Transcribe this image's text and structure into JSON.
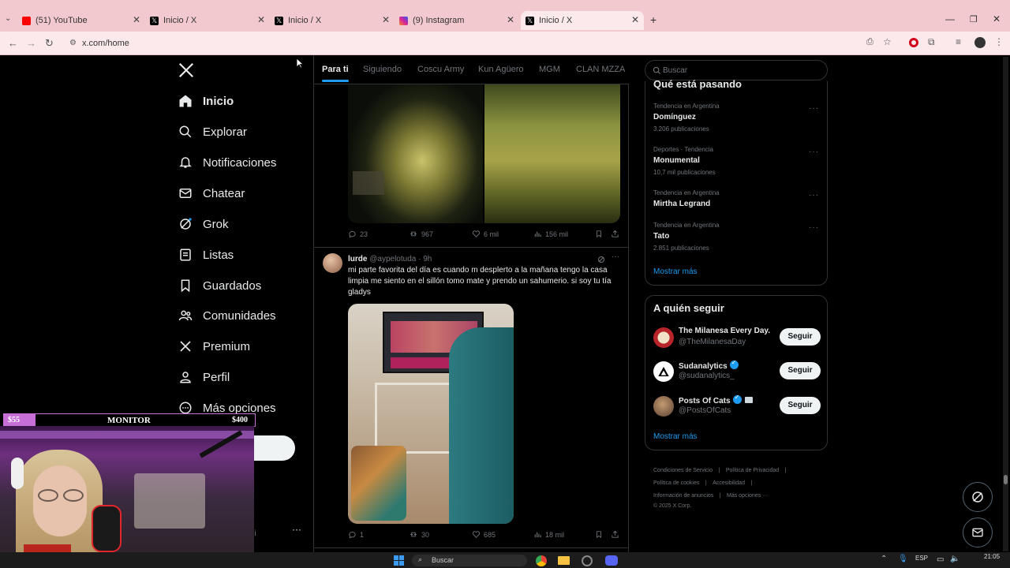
{
  "browser": {
    "tabs": [
      {
        "title": "(51) YouTube",
        "favicon": "youtube-icon",
        "color": "#ff0000"
      },
      {
        "title": "Inicio / X",
        "favicon": "x-icon",
        "color": "#000000"
      },
      {
        "title": "Inicio / X",
        "favicon": "x-icon",
        "color": "#000000"
      },
      {
        "title": "(9) Instagram",
        "favicon": "instagram-icon",
        "color": "#d6249f"
      },
      {
        "title": "Inicio / X",
        "favicon": "x-icon",
        "color": "#000000"
      }
    ],
    "url": "x.com/home"
  },
  "nav": {
    "items": [
      {
        "label": "Inicio",
        "icon": "home-icon"
      },
      {
        "label": "Explorar",
        "icon": "search-icon"
      },
      {
        "label": "Notificaciones",
        "icon": "bell-icon"
      },
      {
        "label": "Chatear",
        "icon": "mail-icon"
      },
      {
        "label": "Grok",
        "icon": "grok-icon"
      },
      {
        "label": "Listas",
        "icon": "list-icon"
      },
      {
        "label": "Guardados",
        "icon": "bookmark-icon"
      },
      {
        "label": "Comunidades",
        "icon": "people-icon"
      },
      {
        "label": "Premium",
        "icon": "x-icon"
      },
      {
        "label": "Perfil",
        "icon": "person-icon"
      },
      {
        "label": "Más opciones",
        "icon": "more-circle-icon"
      }
    ],
    "account_suffix": "ili",
    "account_dots": "···"
  },
  "feed": {
    "tabs": [
      "Para ti",
      "Siguiendo",
      "Coscu Army",
      "Kun Agüero",
      "MGM",
      "CLAN MZZA"
    ],
    "post1": {
      "replies": "23",
      "reposts": "967",
      "likes": "6 mil",
      "views": "156 mil"
    },
    "post2": {
      "name": "lurde",
      "handle": "@aypelotuda",
      "time": "· 9h",
      "text": "mi parte favorita del día es cuando m desplerto a la mañana tengo la casa limpia me siento en el sillón tomo mate y prendo un sahumerio. si soy tu tía gladys",
      "replies": "1",
      "reposts": "30",
      "likes": "685",
      "views": "18 mil"
    }
  },
  "sidebar": {
    "search_placeholder": "Buscar",
    "trends_title": "Qué está pasando",
    "trends": [
      {
        "category": "Tendencia en Argentina",
        "name": "Domínguez",
        "count": "3.206 publicaciones"
      },
      {
        "category": "Deportes · Tendencia",
        "name": "Monumental",
        "count": "10,7 mil publicaciones"
      },
      {
        "category": "Tendencia en Argentina",
        "name": "Mirtha Legrand",
        "count": ""
      },
      {
        "category": "Tendencia en Argentina",
        "name": "Tato",
        "count": "2.851 publicaciones"
      }
    ],
    "trends_more": "Mostrar más",
    "follow_title": "A quién seguir",
    "follow": [
      {
        "name": "The Milanesa Every Day.",
        "handle": "@TheMilanesaDay",
        "verified": false,
        "button": "Seguir"
      },
      {
        "name": "Sudanalytics",
        "handle": "@sudanalytics_",
        "verified": true,
        "button": "Seguir"
      },
      {
        "name": "Posts Of Cats",
        "handle": "@PostsOfCats",
        "verified": true,
        "button": "Seguir"
      }
    ],
    "follow_more": "Mostrar más",
    "footer": [
      "Condiciones de Servicio",
      "|",
      "Política de Privacidad",
      "|",
      "Política de cookies",
      "|",
      "Accesibilidad",
      "|",
      "Información de anuncios",
      "|",
      "Más opciones ···",
      "© 2025 X Corp."
    ]
  },
  "overlay": {
    "left_price": "$55",
    "title": "MONITOR",
    "right_price": "$400"
  },
  "taskbar": {
    "search": "Buscar",
    "lang": "ESP",
    "time": "21:05"
  },
  "colors": {
    "accent": "#1d9bf0",
    "tab_bar": "#f2c9ce",
    "overlay_border": "#c76fd6"
  }
}
